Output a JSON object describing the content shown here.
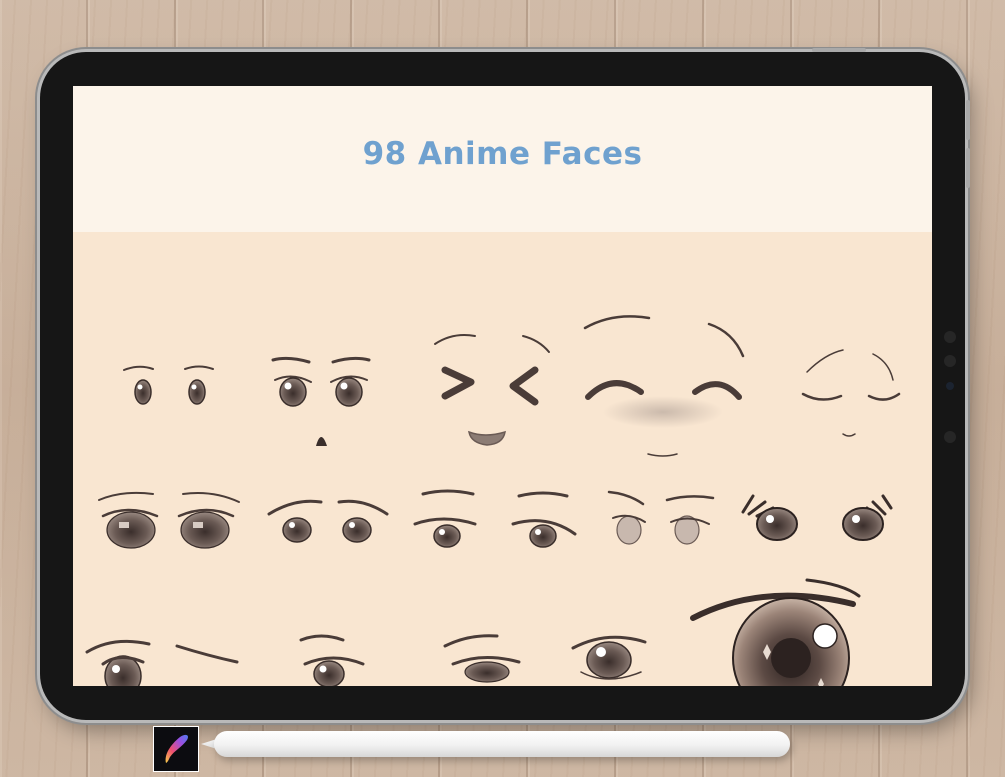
{
  "screen": {
    "title": "98 Anime Faces"
  },
  "colors": {
    "title": "#6fa1cf",
    "header_band": "#fcf4ea",
    "canvas": "#f9e6d1",
    "ink": "#4a3c38",
    "bezel": "#161616"
  },
  "icons": {
    "app_icon": "procreate-brush-icon",
    "stylus": "apple-pencil"
  }
}
